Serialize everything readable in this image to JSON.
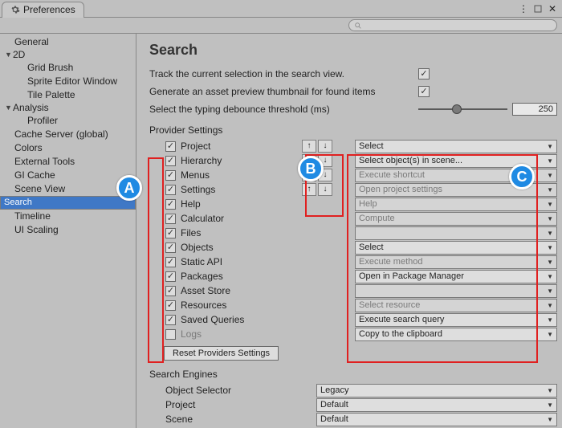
{
  "window": {
    "title": "Preferences"
  },
  "sidebar": {
    "items": [
      {
        "label": "General",
        "indent": 0,
        "caret": ""
      },
      {
        "label": "2D",
        "indent": 0,
        "caret": "▼"
      },
      {
        "label": "Grid Brush",
        "indent": 1,
        "caret": ""
      },
      {
        "label": "Sprite Editor Window",
        "indent": 1,
        "caret": ""
      },
      {
        "label": "Tile Palette",
        "indent": 1,
        "caret": ""
      },
      {
        "label": "Analysis",
        "indent": 0,
        "caret": "▼"
      },
      {
        "label": "Profiler",
        "indent": 1,
        "caret": ""
      },
      {
        "label": "Cache Server (global)",
        "indent": 0,
        "caret": ""
      },
      {
        "label": "Colors",
        "indent": 0,
        "caret": ""
      },
      {
        "label": "External Tools",
        "indent": 0,
        "caret": ""
      },
      {
        "label": "GI Cache",
        "indent": 0,
        "caret": ""
      },
      {
        "label": "Scene View",
        "indent": 0,
        "caret": ""
      },
      {
        "label": "Search",
        "indent": 0,
        "caret": "",
        "selected": true
      },
      {
        "label": "Timeline",
        "indent": 0,
        "caret": ""
      },
      {
        "label": "UI Scaling",
        "indent": 0,
        "caret": ""
      }
    ]
  },
  "page": {
    "title": "Search",
    "track_label": "Track the current selection in the search view.",
    "track_checked": true,
    "thumb_label": "Generate an asset preview thumbnail for found items",
    "thumb_checked": true,
    "debounce_label": "Select the typing debounce threshold (ms)",
    "debounce_value": "250",
    "providers_heading": "Provider Settings",
    "reset_label": "Reset Providers Settings",
    "engines_heading": "Search Engines",
    "providers": [
      {
        "label": "Project",
        "checked": true,
        "arrows": true,
        "action": "Select",
        "disabled": false
      },
      {
        "label": "Hierarchy",
        "checked": true,
        "arrows": true,
        "action": "Select object(s) in scene...",
        "disabled": false
      },
      {
        "label": "Menus",
        "checked": true,
        "arrows": true,
        "action": "Execute shortcut",
        "disabled": true
      },
      {
        "label": "Settings",
        "checked": true,
        "arrows": true,
        "action": "Open project settings",
        "disabled": true
      },
      {
        "label": "Help",
        "checked": true,
        "arrows": false,
        "action": "Help",
        "disabled": true
      },
      {
        "label": "Calculator",
        "checked": true,
        "arrows": false,
        "action": "Compute",
        "disabled": true
      },
      {
        "label": "Files",
        "checked": true,
        "arrows": false,
        "action": "",
        "disabled": true
      },
      {
        "label": "Objects",
        "checked": true,
        "arrows": false,
        "action": "Select",
        "disabled": false
      },
      {
        "label": "Static API",
        "checked": true,
        "arrows": false,
        "action": "Execute method",
        "disabled": true
      },
      {
        "label": "Packages",
        "checked": true,
        "arrows": false,
        "action": "Open in Package Manager",
        "disabled": false
      },
      {
        "label": "Asset Store",
        "checked": true,
        "arrows": false,
        "action": "",
        "disabled": true
      },
      {
        "label": "Resources",
        "checked": true,
        "arrows": false,
        "action": "Select resource",
        "disabled": true
      },
      {
        "label": "Saved Queries",
        "checked": true,
        "arrows": false,
        "action": "Execute search query",
        "disabled": false
      },
      {
        "label": "Logs",
        "checked": false,
        "arrows": false,
        "action": "Copy to the clipboard",
        "disabled": false,
        "labelDisabled": true
      }
    ],
    "engines": [
      {
        "label": "Object Selector",
        "value": "Legacy"
      },
      {
        "label": "Project",
        "value": "Default"
      },
      {
        "label": "Scene",
        "value": "Default"
      }
    ]
  },
  "annotations": {
    "A": "A",
    "B": "B",
    "C": "C"
  }
}
